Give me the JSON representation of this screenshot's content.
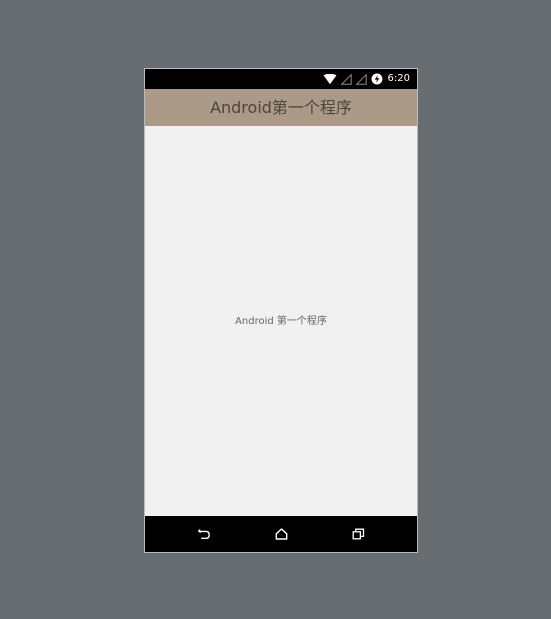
{
  "status_bar": {
    "time": "6:20",
    "icons": [
      "wifi-icon",
      "signal-icon",
      "signal-icon",
      "data-saver-icon"
    ]
  },
  "action_bar": {
    "title": "Android第一个程序",
    "background_color": "#ab9a88"
  },
  "content": {
    "text": "Android 第一个程序"
  },
  "navigation_bar": {
    "buttons": [
      "back-icon",
      "home-icon",
      "recent-apps-icon"
    ]
  },
  "colors": {
    "page_background": "#676d71",
    "screen_background": "#f1f1f1",
    "system_bar": "#000000"
  }
}
